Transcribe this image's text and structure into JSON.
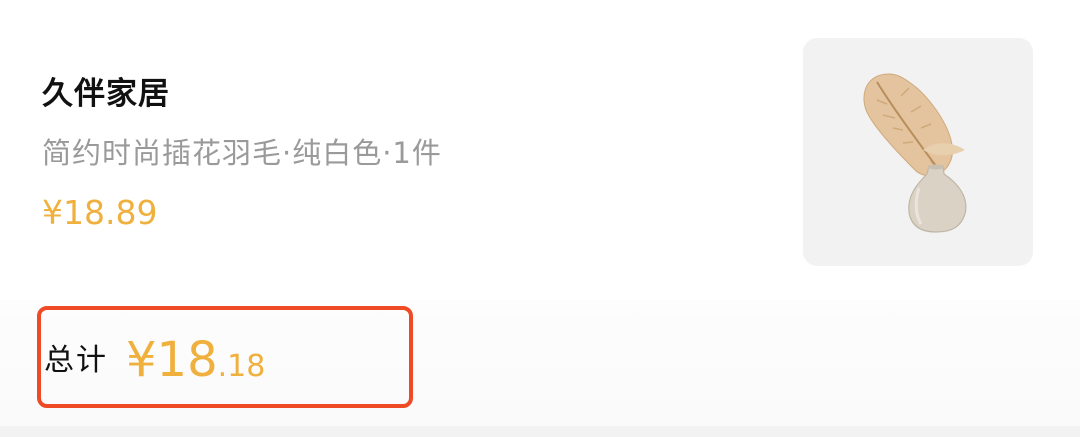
{
  "product": {
    "shop_name": "久伴家居",
    "description": "简约时尚插花羽毛·纯白色·1件",
    "price": "¥18.89",
    "image_icon": "feather-vase-image"
  },
  "summary": {
    "total_label": "总计",
    "total_main": "¥18",
    "total_cents": ".18"
  },
  "colors": {
    "accent_price": "#f0b03d",
    "highlight_border": "#ee4a25",
    "muted_text": "#9a9a9a"
  }
}
